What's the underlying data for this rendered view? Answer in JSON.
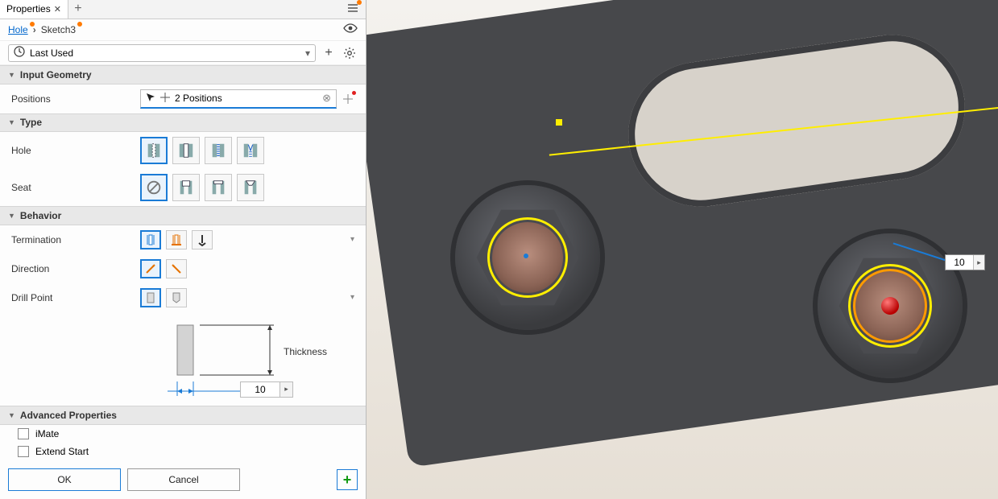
{
  "tab": {
    "title": "Properties"
  },
  "breadcrumb": {
    "root": "Hole",
    "current": "Sketch3"
  },
  "preset": {
    "value": "Last Used"
  },
  "sections": {
    "inputGeometry": "Input Geometry",
    "type": "Type",
    "behavior": "Behavior",
    "advanced": "Advanced Properties"
  },
  "labels": {
    "positions": "Positions",
    "hole": "Hole",
    "seat": "Seat",
    "termination": "Termination",
    "direction": "Direction",
    "drillPoint": "Drill Point",
    "thickness": "Thickness",
    "imate": "iMate",
    "extendStart": "Extend Start"
  },
  "positions": {
    "value": "2 Positions"
  },
  "dims": {
    "diameter": "10"
  },
  "viewportDim": {
    "value": "10"
  },
  "buttons": {
    "ok": "OK",
    "cancel": "Cancel"
  }
}
